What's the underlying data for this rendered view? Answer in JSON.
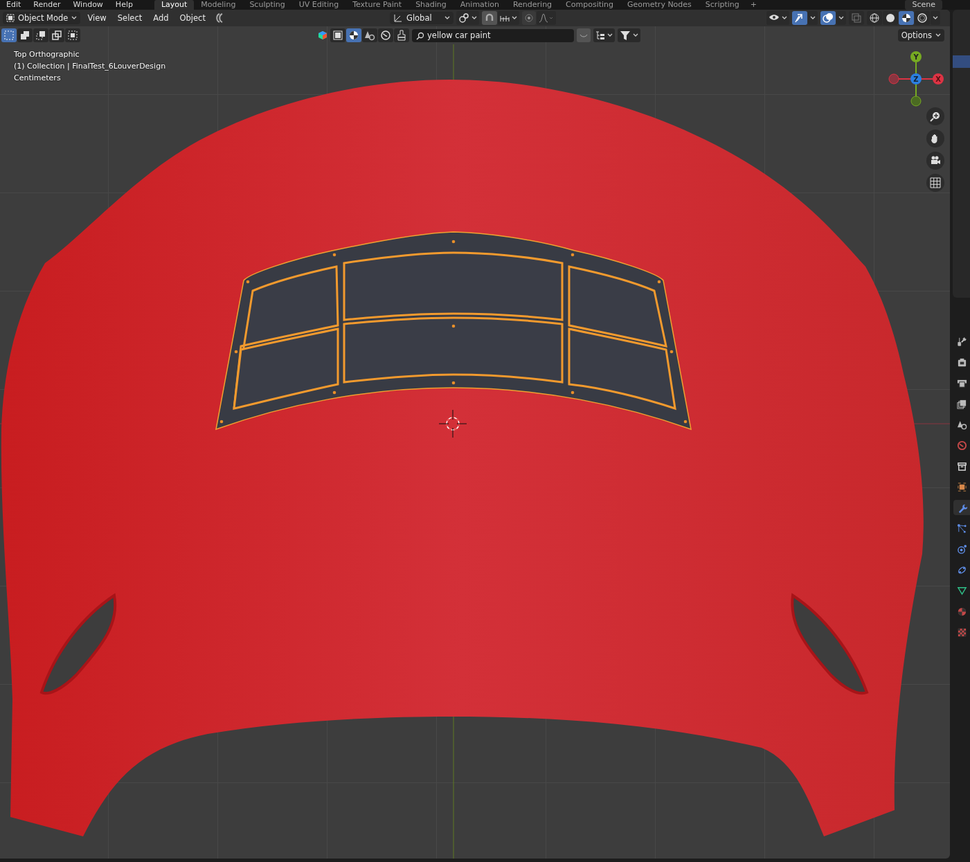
{
  "menu": [
    "Edit",
    "Render",
    "Window",
    "Help"
  ],
  "workspaces": [
    {
      "label": "Layout",
      "selected": true
    },
    {
      "label": "Modeling",
      "selected": false
    },
    {
      "label": "Sculpting",
      "selected": false
    },
    {
      "label": "UV Editing",
      "selected": false
    },
    {
      "label": "Texture Paint",
      "selected": false
    },
    {
      "label": "Shading",
      "selected": false
    },
    {
      "label": "Animation",
      "selected": false
    },
    {
      "label": "Rendering",
      "selected": false
    },
    {
      "label": "Compositing",
      "selected": false
    },
    {
      "label": "Geometry Nodes",
      "selected": false
    },
    {
      "label": "Scripting",
      "selected": false
    }
  ],
  "add_workspace": "+",
  "scene": "Scene",
  "header": {
    "mode": "Object Mode",
    "menus": [
      "View",
      "Select",
      "Add",
      "Object"
    ],
    "orientation": "Global"
  },
  "shading_modes": [
    {
      "kind": "wireframe",
      "selected": false
    },
    {
      "kind": "solid",
      "selected": false
    },
    {
      "kind": "material",
      "selected": true
    },
    {
      "kind": "rendered",
      "selected": false
    }
  ],
  "selection_modes": [
    {
      "kind": "set",
      "selected": true
    },
    {
      "kind": "extend",
      "selected": false
    },
    {
      "kind": "subtract",
      "selected": false
    },
    {
      "kind": "invert",
      "selected": false
    },
    {
      "kind": "intersect",
      "selected": false
    }
  ],
  "search": {
    "value": "yellow car paint"
  },
  "options": "Options",
  "overlay_text": [
    "Top Orthographic",
    "(1) Collection | FinalTest_6LouverDesign",
    "Centimeters"
  ],
  "gizmo_labels": [
    "Y",
    "Z",
    "X"
  ],
  "properties_tabs": [
    {
      "kind": "tool",
      "selected": false
    },
    {
      "kind": "render",
      "selected": false
    },
    {
      "kind": "output",
      "selected": false
    },
    {
      "kind": "view_layer",
      "selected": false
    },
    {
      "kind": "scene",
      "selected": false
    },
    {
      "kind": "world",
      "selected": false
    },
    {
      "kind": "collection",
      "selected": false
    },
    {
      "kind": "object",
      "selected": false
    },
    {
      "kind": "modifiers",
      "selected": true
    },
    {
      "kind": "particles",
      "selected": false
    },
    {
      "kind": "physics",
      "selected": false
    },
    {
      "kind": "constraints",
      "selected": false
    },
    {
      "kind": "data",
      "selected": false
    },
    {
      "kind": "material",
      "selected": false
    },
    {
      "kind": "texture",
      "selected": false
    }
  ]
}
